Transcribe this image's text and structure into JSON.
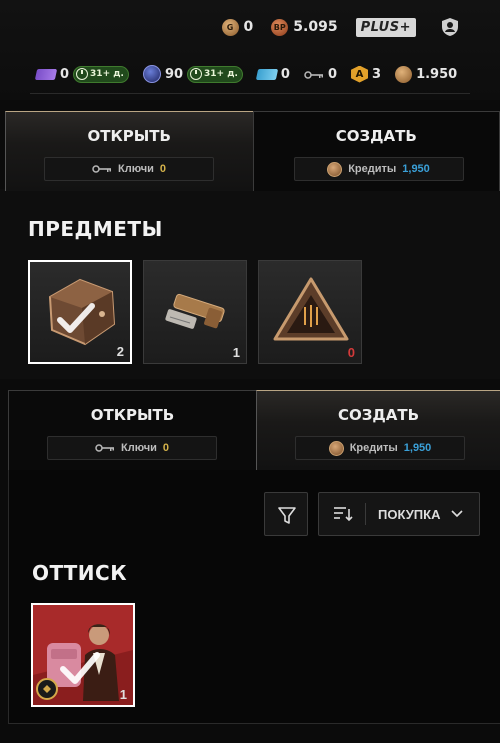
{
  "header": {
    "g_label": "G",
    "g_amount": "0",
    "bp_label": "BP",
    "bp_amount": "5.095",
    "plus_label": "PLUS+",
    "profile_icon": "profile-shield-icon"
  },
  "currencies": {
    "purple_ticket": "0",
    "purple_timer": "31+ д.",
    "orb": "90",
    "orb_timer": "31+ д.",
    "blue_ticket": "0",
    "keys": "0",
    "a_label": "A",
    "a_tokens": "3",
    "credits": "1.950"
  },
  "panel1": {
    "tab_open": "ОТКРЫТЬ",
    "tab_create": "СОЗДАТЬ",
    "keys_label": "Ключи",
    "keys_value": "0",
    "credits_label": "Кредиты",
    "credits_value": "1,950",
    "section_title": "ПРЕДМЕТЫ",
    "items": [
      {
        "name": "crate",
        "count": "2"
      },
      {
        "name": "key-item",
        "count": "1"
      },
      {
        "name": "triangle-token",
        "count": "0"
      }
    ]
  },
  "panel2": {
    "tab_open": "ОТКРЫТЬ",
    "tab_create": "СОЗДАТЬ",
    "keys_label": "Ключи",
    "keys_value": "0",
    "credits_label": "Кредиты",
    "credits_value": "1,950",
    "sort_label": "ПОКУПКА",
    "section_title": "ОТТИСК",
    "items": [
      {
        "name": "imprint-skin",
        "count": "1"
      }
    ]
  },
  "colors": {
    "accent_gold": "#d4b24a",
    "accent_blue": "#3aa0d8",
    "zero_red": "#d43a3a",
    "timer_green": "#214a1c"
  }
}
